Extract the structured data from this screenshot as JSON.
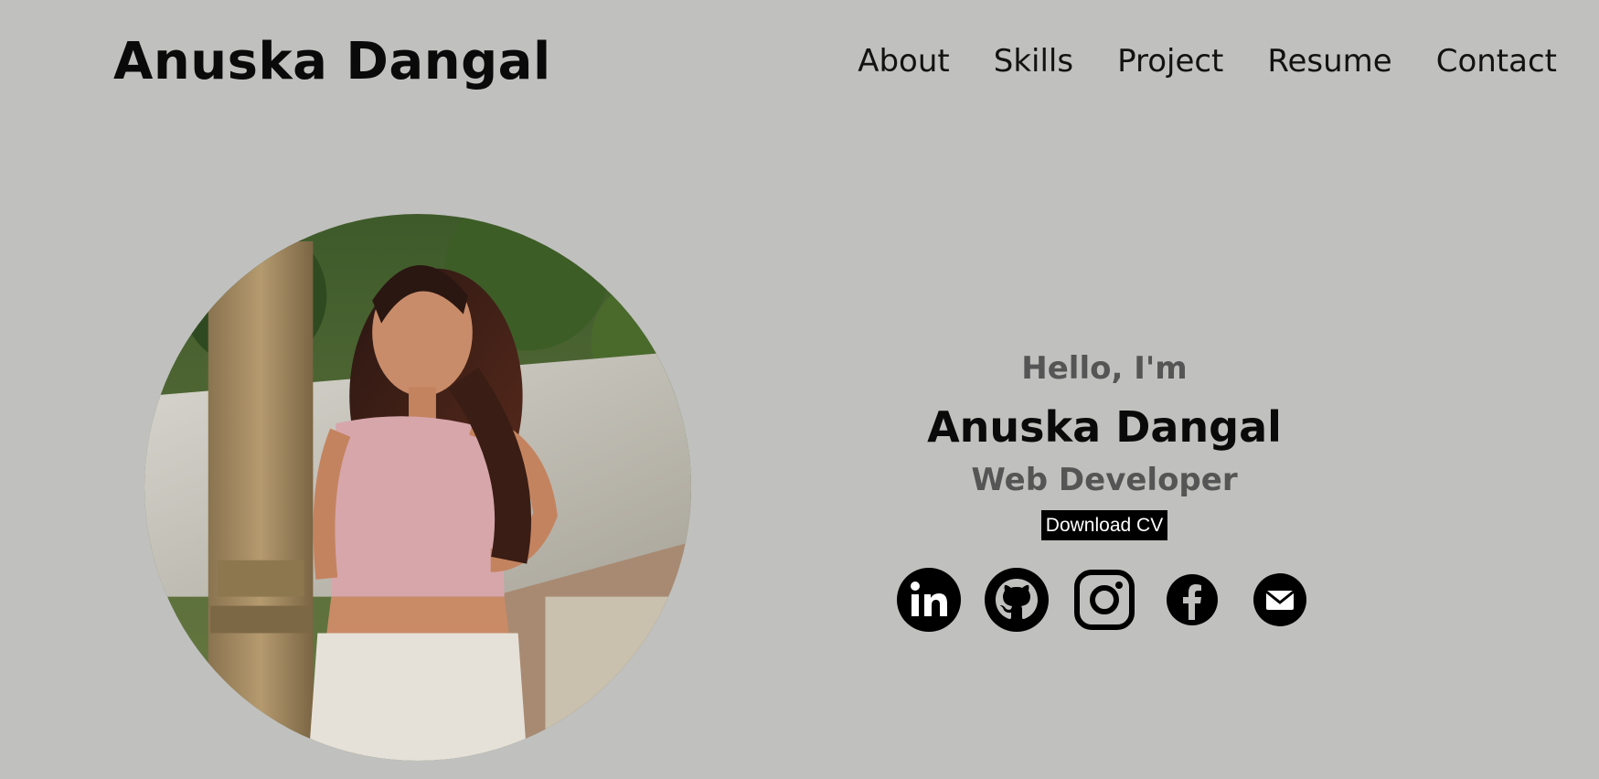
{
  "header": {
    "logo": "Anuska Dangal",
    "nav": [
      {
        "label": "About"
      },
      {
        "label": "Skills"
      },
      {
        "label": "Project"
      },
      {
        "label": "Resume"
      },
      {
        "label": "Contact"
      }
    ]
  },
  "hero": {
    "greeting": "Hello, I'm",
    "name": "Anuska Dangal",
    "role": "Web Developer",
    "cv_button": "Download CV"
  },
  "socials": [
    {
      "icon": "linkedin-icon"
    },
    {
      "icon": "github-icon"
    },
    {
      "icon": "instagram-icon"
    },
    {
      "icon": "facebook-icon"
    },
    {
      "icon": "email-icon"
    }
  ],
  "colors": {
    "background": "#c0c0be",
    "text_dark": "#0a0a0a",
    "text_muted": "#555555",
    "button_bg": "#000000",
    "button_text": "#ffffff"
  }
}
